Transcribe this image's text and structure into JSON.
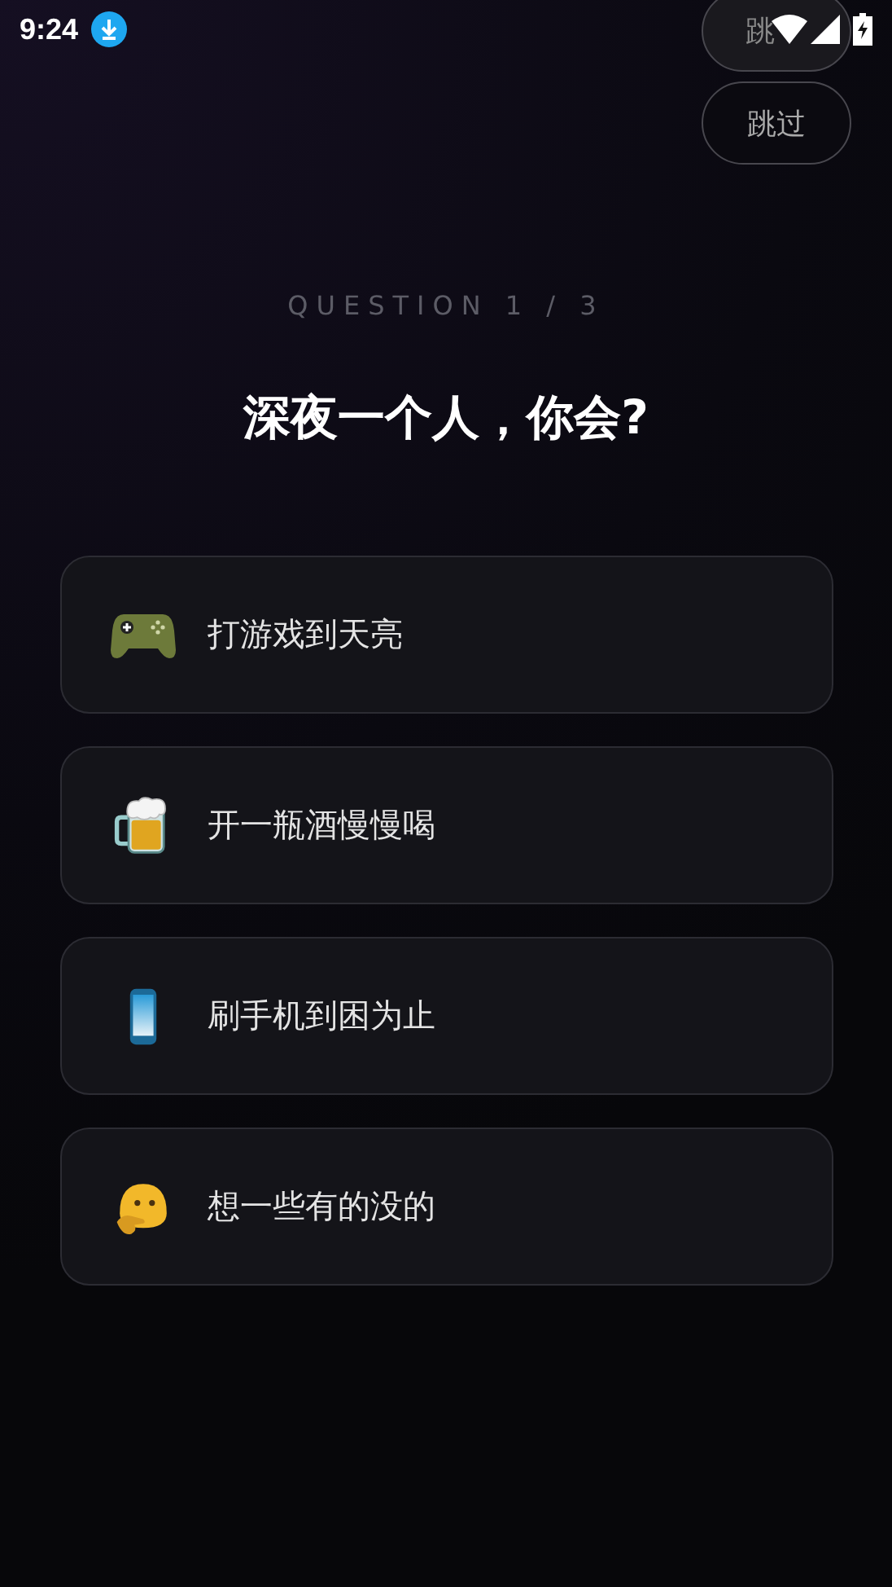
{
  "status_bar": {
    "time": "9:24"
  },
  "skip_buttons": [
    "跳",
    "跳过"
  ],
  "question": {
    "label": "QUESTION 1 / 3",
    "title": "深夜一个人，你会?"
  },
  "options": [
    {
      "kind": "gamepad",
      "label": "打游戏到天亮"
    },
    {
      "kind": "beer",
      "label": "开一瓶酒慢慢喝"
    },
    {
      "kind": "phone",
      "label": "刷手机到困为止"
    },
    {
      "kind": "thinking",
      "label": "想一些有的没的"
    }
  ]
}
